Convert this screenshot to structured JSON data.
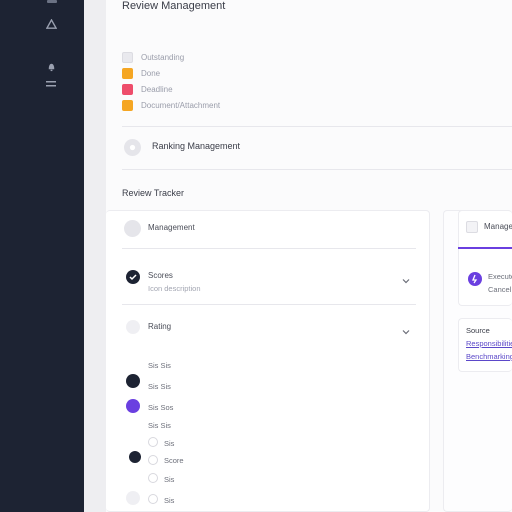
{
  "header": {
    "title": "Review Management"
  },
  "legend": [
    {
      "label": "Outstanding",
      "color": "#e9e9ee"
    },
    {
      "label": "Done",
      "color": "#f5a623"
    },
    {
      "label": "Deadline",
      "color": "#ee4d6b"
    },
    {
      "label": "Document/Attachment",
      "color": "#f5a623"
    }
  ],
  "row": {
    "label": "Ranking Management"
  },
  "section": {
    "title": "Review Tracker"
  },
  "tracker": {
    "header_label": "Management",
    "item1": {
      "title": "Scores",
      "subtitle": "Icon description"
    },
    "item2": {
      "title": "Rating"
    },
    "subitems": [
      {
        "label": "Sis Sis"
      },
      {
        "label": "Sis Sis"
      },
      {
        "label": "Sis Sos"
      },
      {
        "label": "Sis Sis"
      },
      {
        "label": "Sis"
      },
      {
        "label": "Score"
      },
      {
        "label": "Sis"
      },
      {
        "label": "Sis"
      }
    ]
  },
  "right_card": {
    "title": "Manage",
    "item_title": "Execute",
    "item_sub": "Cancel"
  },
  "right_card2": {
    "title": "Source",
    "link1": "Responsibilities",
    "link2": "Benchmarking"
  },
  "colors": {
    "sidebar": "#1d2333",
    "accent_purple": "#6a3fe0",
    "accent_orange": "#f5a623",
    "accent_red": "#ee4d6b"
  },
  "icons": [
    "home-icon",
    "bell-icon",
    "settings-icon",
    "check-icon",
    "chevron-down-icon"
  ]
}
